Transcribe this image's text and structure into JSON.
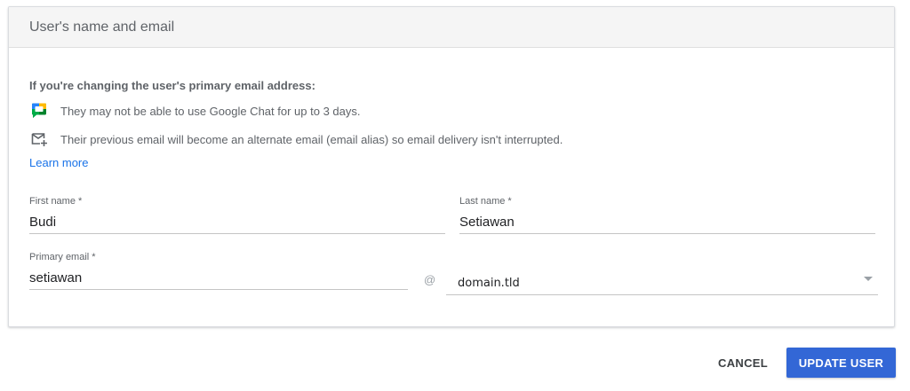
{
  "card": {
    "title": "User's name and email"
  },
  "info": {
    "heading": "If you're changing the user's primary email address:",
    "chat_notice": "They may not be able to use Google Chat for up to 3 days.",
    "mail_notice": "Their previous email will become an alternate email (email alias) so email delivery isn't interrupted.",
    "learn_more": "Learn more"
  },
  "form": {
    "first_name": {
      "label": "First name *",
      "value": "Budi"
    },
    "last_name": {
      "label": "Last name *",
      "value": "Setiawan"
    },
    "primary_email": {
      "label": "Primary email *",
      "value": "setiawan"
    },
    "at_sign": "@",
    "domain": {
      "selected": "domain.tld"
    }
  },
  "actions": {
    "cancel": "CANCEL",
    "update": "UPDATE USER"
  },
  "colors": {
    "accent": "#3367d6",
    "link": "#1a73e8"
  }
}
